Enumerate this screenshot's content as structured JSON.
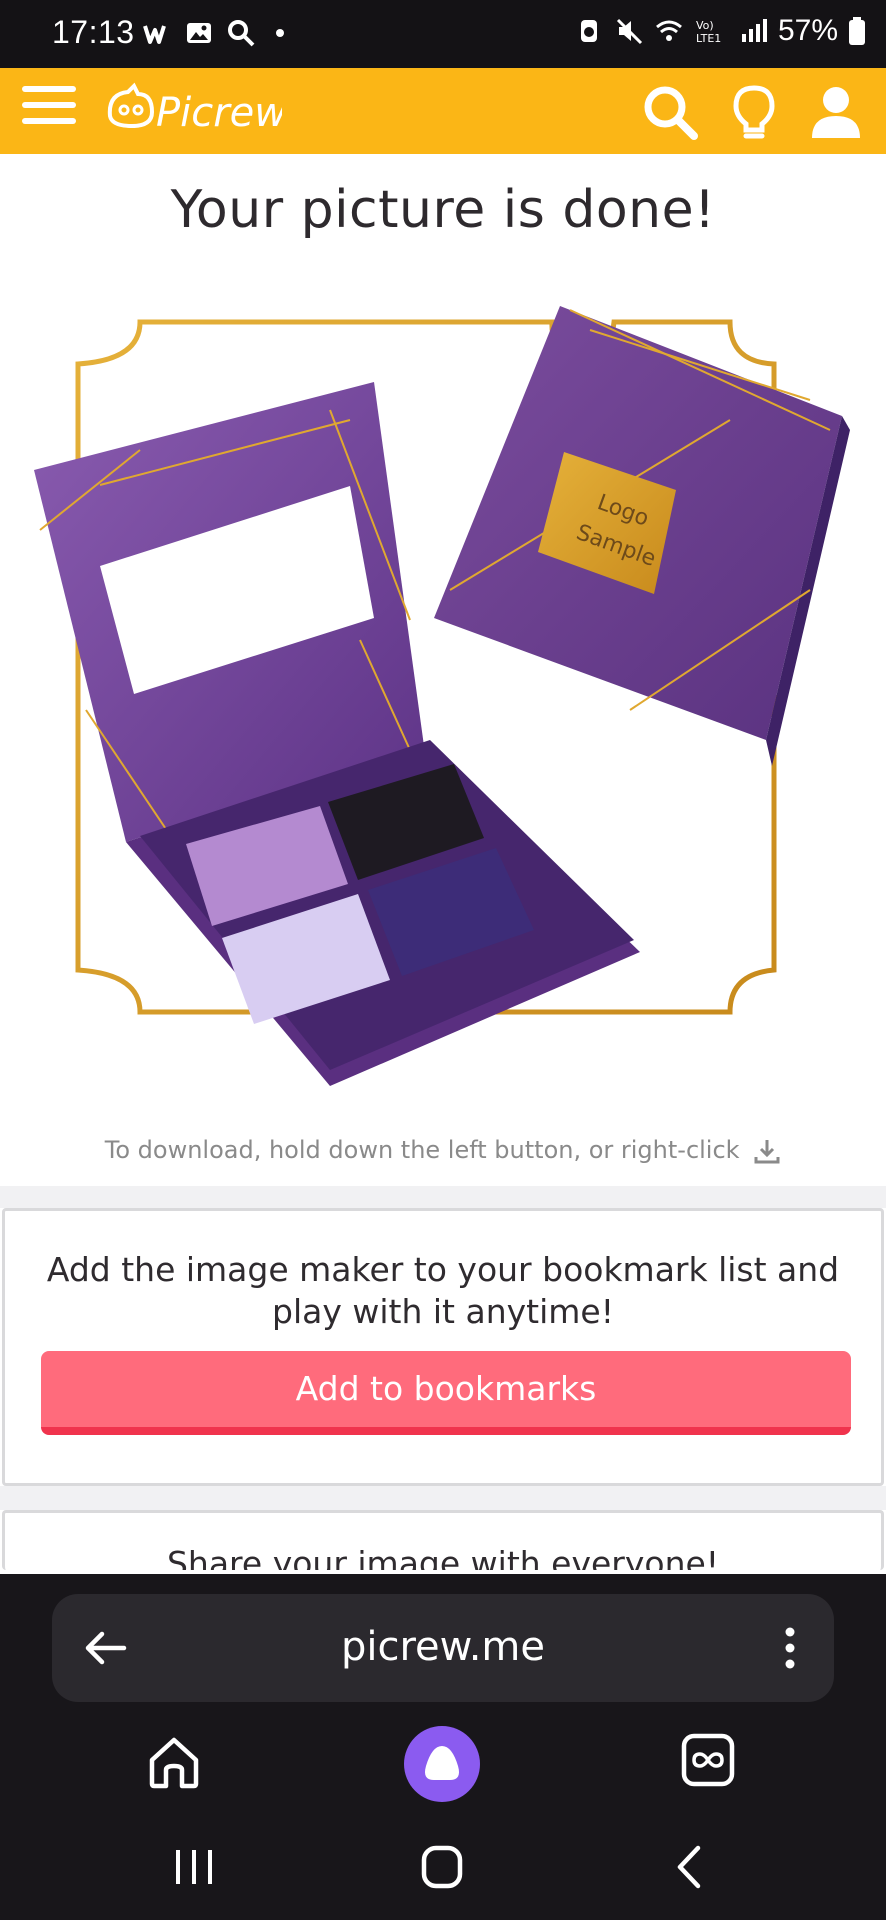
{
  "status_bar": {
    "time": "17:13",
    "battery": "57%",
    "network_label": "Vo) LTE1"
  },
  "header": {
    "logo_text": "Picrew",
    "brand_color": "#fbb616",
    "icons": [
      "menu-icon",
      "search-icon",
      "lightbulb-icon",
      "user-icon"
    ]
  },
  "main": {
    "title": "Your picture is done!",
    "picture": {
      "logo_label_line1": "Logo",
      "logo_label_line2": "Sample"
    },
    "download_hint": "To download, hold down the left button, or right-click"
  },
  "bookmark_card": {
    "text": "Add the image maker to your bookmark list and play with it anytime!",
    "button_label": "Add to bookmarks",
    "button_color": "#ff6b7c"
  },
  "share_card": {
    "text": "Share your image with everyone!"
  },
  "browser": {
    "url": "picrew.me",
    "accent_color": "#8b5bf0"
  }
}
